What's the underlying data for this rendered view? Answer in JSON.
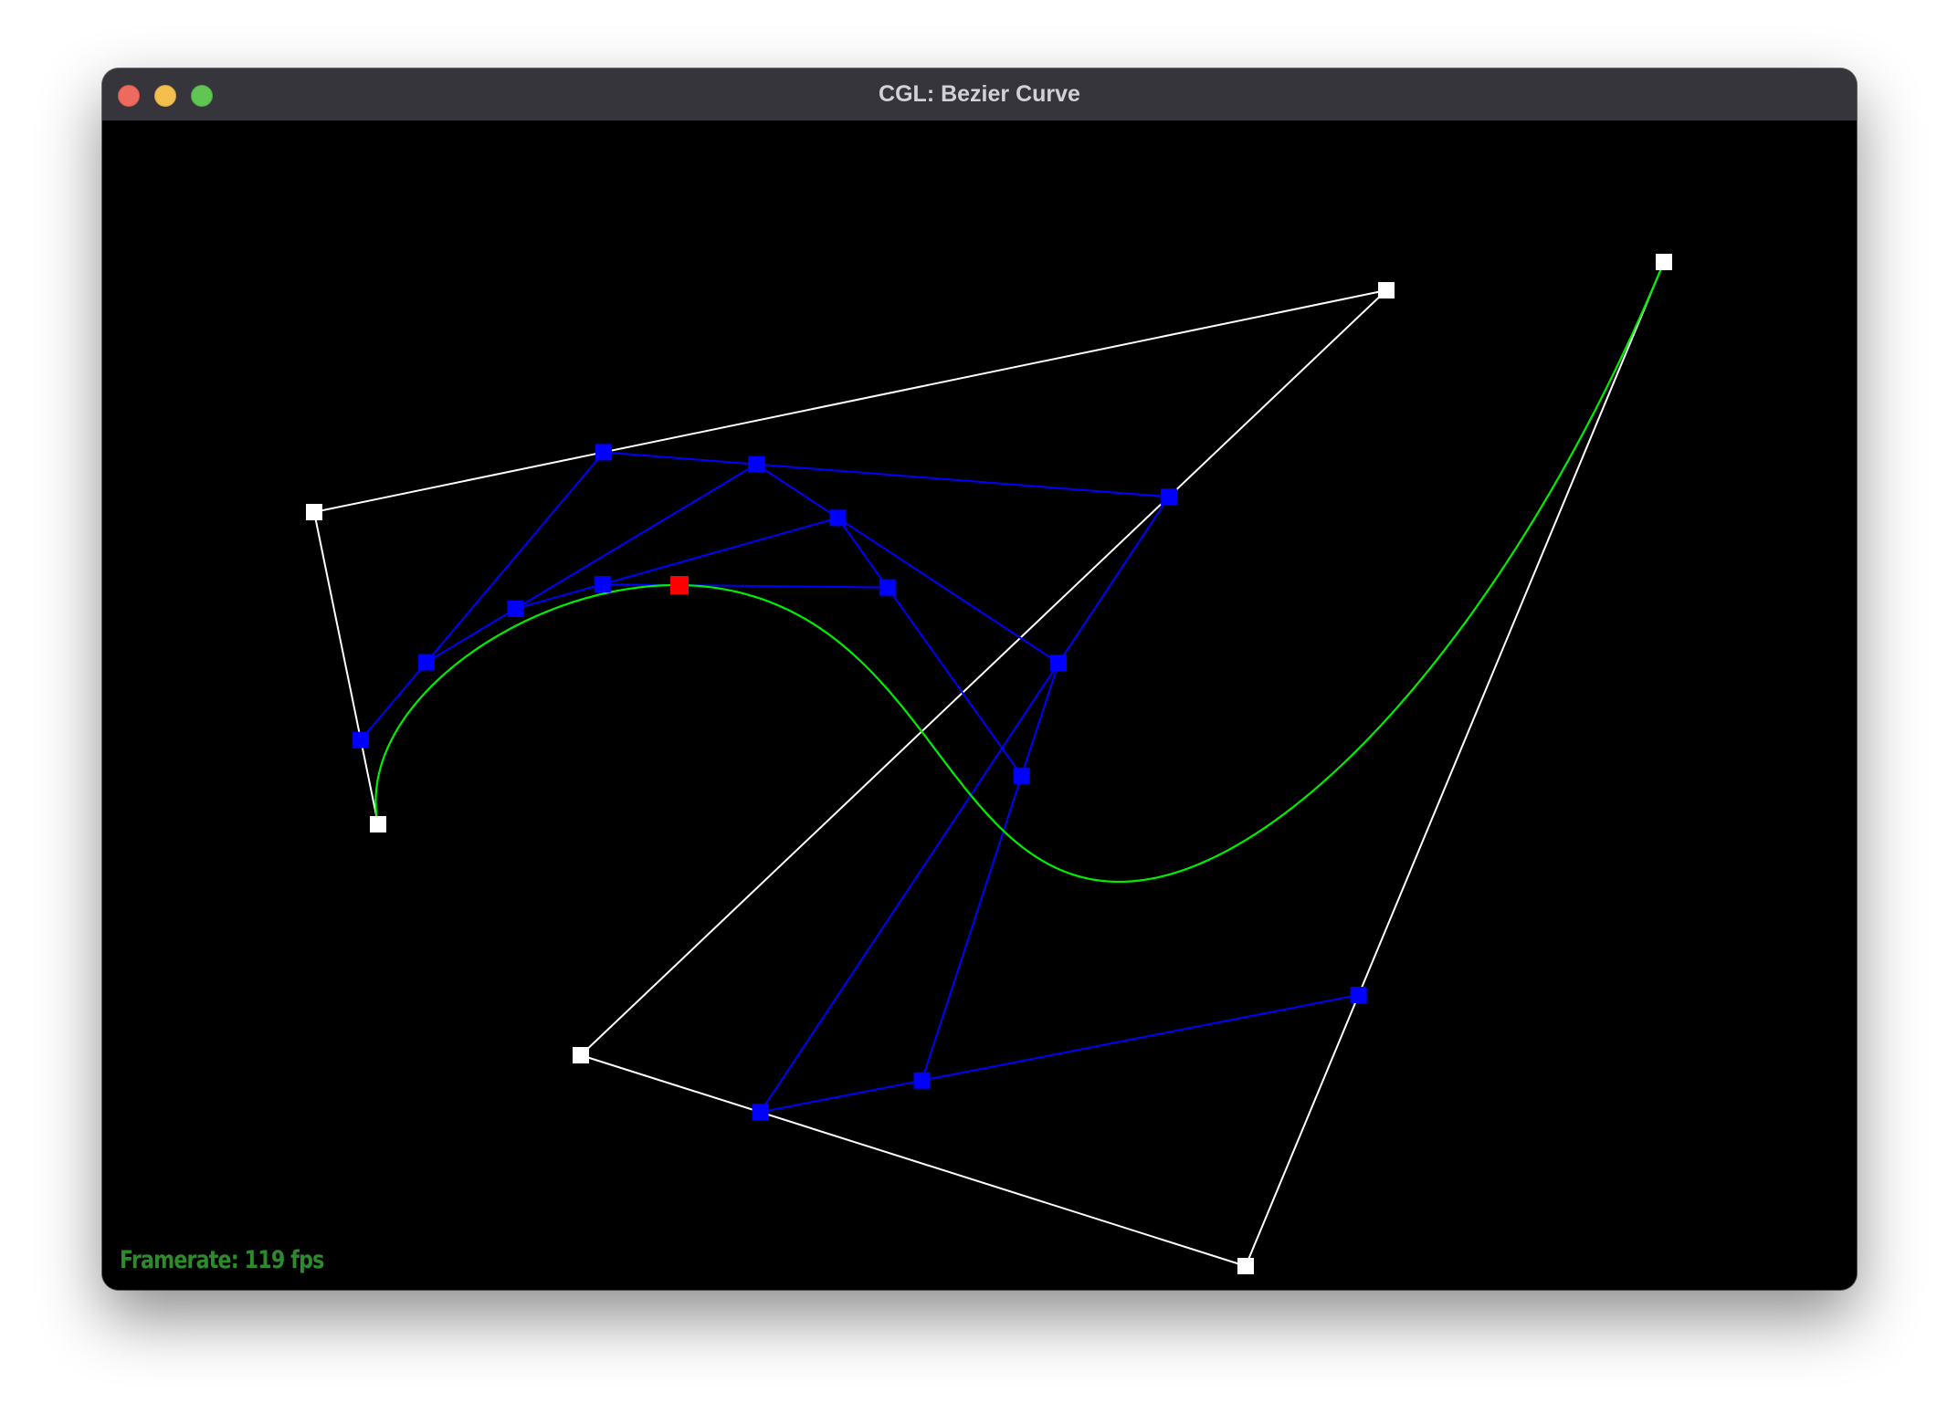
{
  "window": {
    "title": "CGL: Bezier Curve"
  },
  "status": {
    "framerate_text": "Framerate: 119 fps"
  },
  "colors": {
    "control_polygon": "#ffffff",
    "intermediate": "#0000ff",
    "curve": "#00ee00",
    "evaluated_point": "#ff0000",
    "framerate": "#2d8a2d",
    "background": "#000000"
  }
}
